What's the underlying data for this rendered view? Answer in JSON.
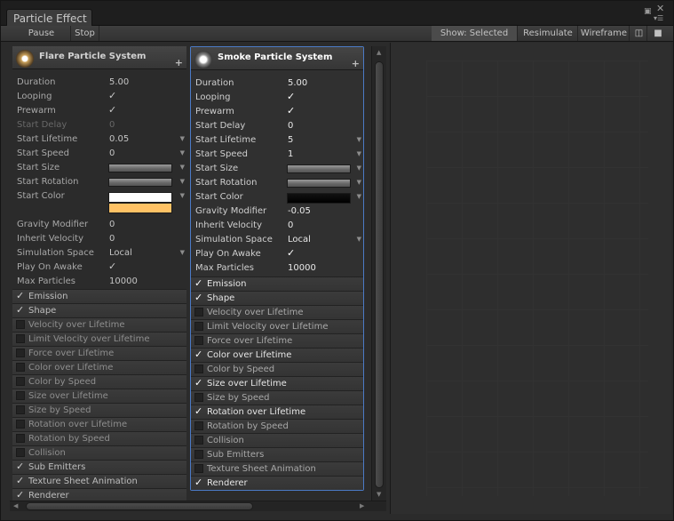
{
  "window": {
    "tab_title": "Particle Effect",
    "menu_icon": "menu-icon",
    "close_icon": "close-icon"
  },
  "toolbar": {
    "pause": "Pause",
    "stop": "Stop",
    "show_selected": "Show: Selected",
    "resimulate": "Resimulate",
    "wireframe": "Wireframe",
    "layout_icon": "layout-icon",
    "lock_icon": "lock-icon"
  },
  "flare": {
    "title": "Flare Particle System",
    "props": {
      "duration": {
        "label": "Duration",
        "value": "5.00"
      },
      "looping": {
        "label": "Looping"
      },
      "prewarm": {
        "label": "Prewarm"
      },
      "start_delay": {
        "label": "Start Delay",
        "value": "0"
      },
      "start_lifetime": {
        "label": "Start Lifetime",
        "value": "0.05"
      },
      "start_speed": {
        "label": "Start Speed",
        "value": "0"
      },
      "start_size": {
        "label": "Start Size"
      },
      "start_rotation": {
        "label": "Start Rotation"
      },
      "start_color": {
        "label": "Start Color"
      },
      "gravity_modifier": {
        "label": "Gravity Modifier",
        "value": "0"
      },
      "inherit_velocity": {
        "label": "Inherit Velocity",
        "value": "0"
      },
      "simulation_space": {
        "label": "Simulation Space",
        "value": "Local"
      },
      "play_on_awake": {
        "label": "Play On Awake"
      },
      "max_particles": {
        "label": "Max Particles",
        "value": "10000"
      }
    },
    "modules": [
      {
        "label": "Emission",
        "checked": true
      },
      {
        "label": "Shape",
        "checked": true
      },
      {
        "label": "Velocity over Lifetime",
        "checked": false
      },
      {
        "label": "Limit Velocity over Lifetime",
        "checked": false
      },
      {
        "label": "Force over Lifetime",
        "checked": false
      },
      {
        "label": "Color over Lifetime",
        "checked": false
      },
      {
        "label": "Color by Speed",
        "checked": false
      },
      {
        "label": "Size over Lifetime",
        "checked": false
      },
      {
        "label": "Size by Speed",
        "checked": false
      },
      {
        "label": "Rotation over Lifetime",
        "checked": false
      },
      {
        "label": "Rotation by Speed",
        "checked": false
      },
      {
        "label": "Collision",
        "checked": false
      },
      {
        "label": "Sub Emitters",
        "checked": true
      },
      {
        "label": "Texture Sheet Animation",
        "checked": true
      },
      {
        "label": "Renderer",
        "checked": true
      }
    ]
  },
  "smoke": {
    "title": "Smoke Particle System",
    "props": {
      "duration": {
        "label": "Duration",
        "value": "5.00"
      },
      "looping": {
        "label": "Looping"
      },
      "prewarm": {
        "label": "Prewarm"
      },
      "start_delay": {
        "label": "Start Delay",
        "value": "0"
      },
      "start_lifetime": {
        "label": "Start Lifetime",
        "value": "5"
      },
      "start_speed": {
        "label": "Start Speed",
        "value": "1"
      },
      "start_size": {
        "label": "Start Size"
      },
      "start_rotation": {
        "label": "Start Rotation"
      },
      "start_color": {
        "label": "Start Color"
      },
      "gravity_modifier": {
        "label": "Gravity Modifier",
        "value": "-0.05"
      },
      "inherit_velocity": {
        "label": "Inherit Velocity",
        "value": "0"
      },
      "simulation_space": {
        "label": "Simulation Space",
        "value": "Local"
      },
      "play_on_awake": {
        "label": "Play On Awake"
      },
      "max_particles": {
        "label": "Max Particles",
        "value": "10000"
      }
    },
    "modules": [
      {
        "label": "Emission",
        "checked": true
      },
      {
        "label": "Shape",
        "checked": true
      },
      {
        "label": "Velocity over Lifetime",
        "checked": false
      },
      {
        "label": "Limit Velocity over Lifetime",
        "checked": false
      },
      {
        "label": "Force over Lifetime",
        "checked": false
      },
      {
        "label": "Color over Lifetime",
        "checked": true
      },
      {
        "label": "Color by Speed",
        "checked": false
      },
      {
        "label": "Size over Lifetime",
        "checked": true
      },
      {
        "label": "Size by Speed",
        "checked": false
      },
      {
        "label": "Rotation over Lifetime",
        "checked": true
      },
      {
        "label": "Rotation by Speed",
        "checked": false
      },
      {
        "label": "Collision",
        "checked": false
      },
      {
        "label": "Sub Emitters",
        "checked": false
      },
      {
        "label": "Texture Sheet Animation",
        "checked": false
      },
      {
        "label": "Renderer",
        "checked": true
      }
    ]
  },
  "colors": {
    "selection_border": "#4b7ac6",
    "flare_color_top": "#ffffff",
    "flare_color_bottom": "#ffc265",
    "smoke_color": "#000000"
  }
}
